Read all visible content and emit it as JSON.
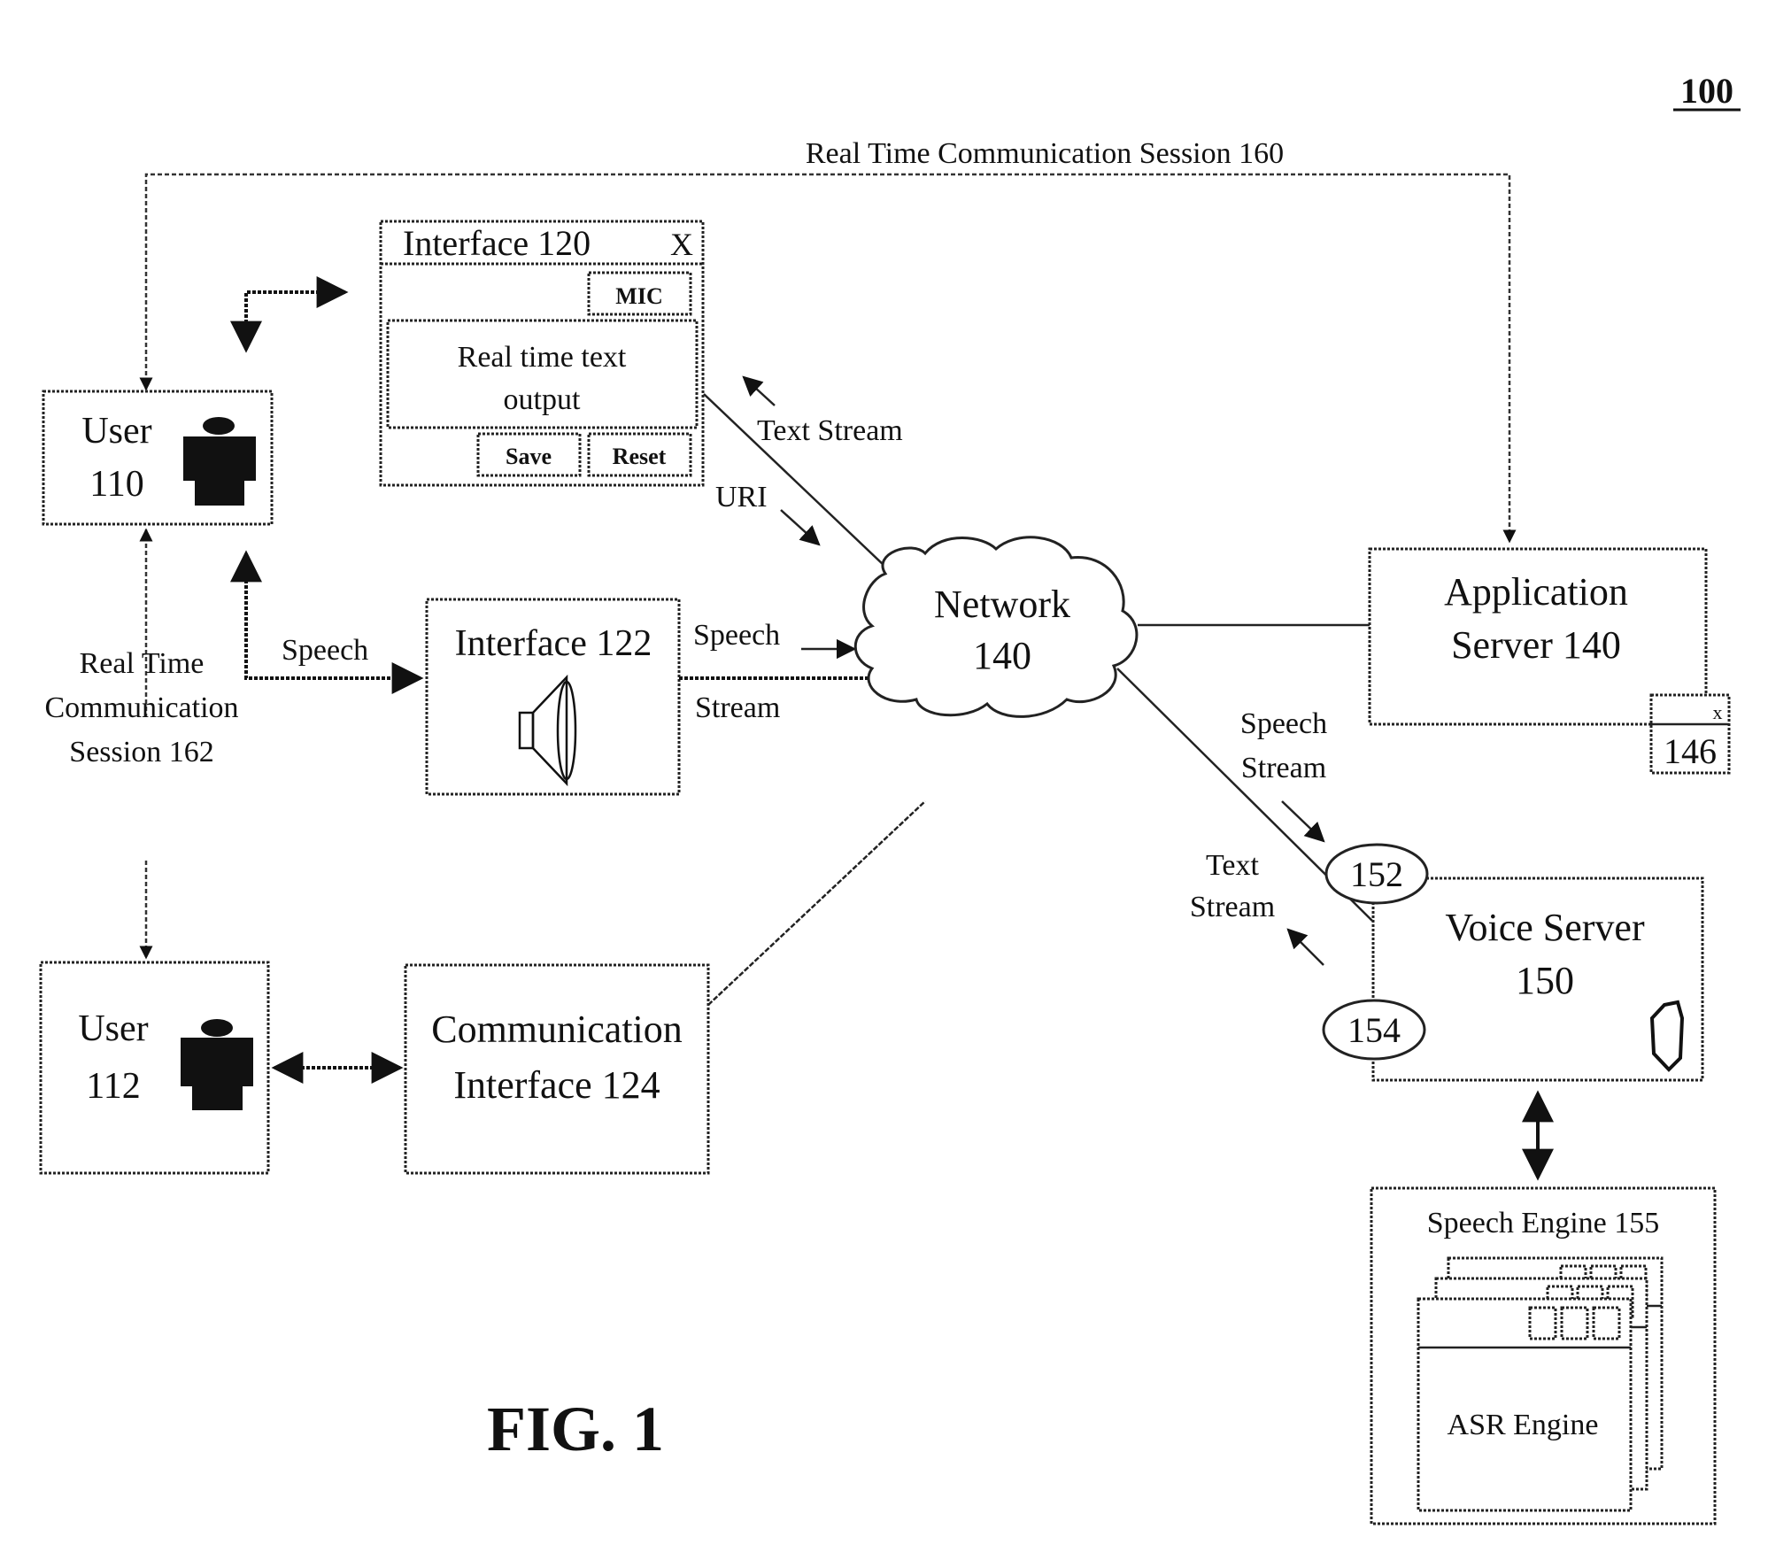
{
  "figure": {
    "reference_number": "100",
    "caption": "FIG. 1"
  },
  "sessions": {
    "session_160": "Real Time Communication Session 160",
    "session_162_lines": [
      "Real Time",
      "Communication",
      "Session 162"
    ]
  },
  "users": {
    "user_110": {
      "line1": "User",
      "line2": "110"
    },
    "user_112": {
      "line1": "User",
      "line2": "112"
    }
  },
  "interface_120": {
    "title": "Interface 120",
    "close": "X",
    "mic_button": "MIC",
    "output_lines": [
      "Real time text",
      "output"
    ],
    "save_button": "Save",
    "reset_button": "Reset"
  },
  "interface_122": {
    "title": "Interface 122"
  },
  "interface_124": {
    "line1": "Communication",
    "line2": "Interface 124"
  },
  "network": {
    "line1": "Network",
    "line2": "140"
  },
  "app_server": {
    "line1": "Application",
    "line2": "Server 140"
  },
  "widget_146": {
    "close": "x",
    "label": "146"
  },
  "voice_server": {
    "line1": "Voice Server",
    "line2": "150",
    "port_152": "152",
    "port_154": "154"
  },
  "speech_engine": {
    "title": "Speech Engine 155",
    "asr": "ASR Engine"
  },
  "labels": {
    "text_stream_top": "Text Stream",
    "uri": "URI",
    "speech": "Speech",
    "speech_stream_1": "Speech",
    "speech_stream_2": "Stream",
    "vs_speech_1": "Speech",
    "vs_speech_2": "Stream",
    "vs_text_1": "Text",
    "vs_text_2": "Stream"
  }
}
